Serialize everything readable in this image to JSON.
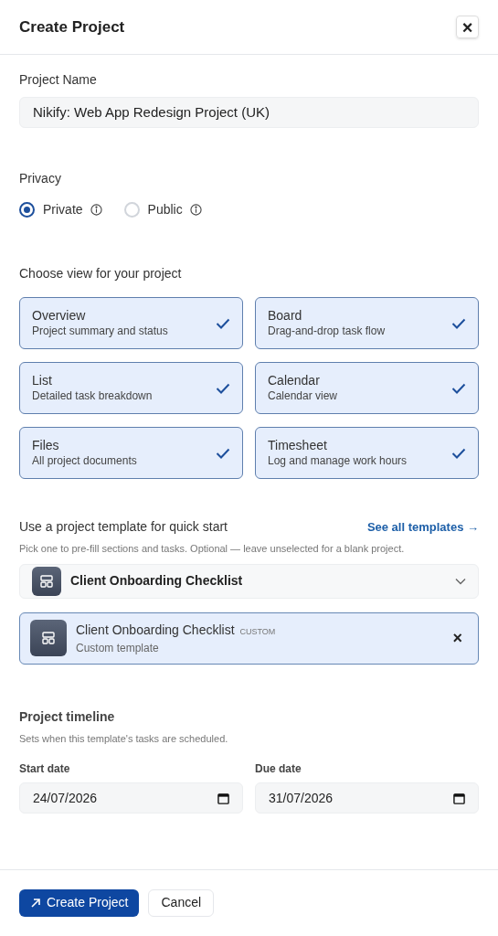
{
  "dialog": {
    "title": "Create Project",
    "close": "×"
  },
  "project_name": {
    "label": "Project Name",
    "value": "Nikify: Web App Redesign Project (UK)"
  },
  "privacy": {
    "label": "Privacy",
    "options": [
      {
        "label": "Private",
        "selected": true
      },
      {
        "label": "Public",
        "selected": false
      }
    ]
  },
  "views": {
    "label": "Choose view for your project",
    "items": [
      {
        "title": "Overview",
        "description": "Project summary and status",
        "selected": true
      },
      {
        "title": "Board",
        "description": "Drag-and-drop task flow",
        "selected": true
      },
      {
        "title": "List",
        "description": "Detailed task breakdown",
        "selected": true
      },
      {
        "title": "Calendar",
        "description": "Calendar view",
        "selected": true
      },
      {
        "title": "Files",
        "description": "All project documents",
        "selected": true
      },
      {
        "title": "Timesheet",
        "description": "Log and manage work hours",
        "selected": true
      }
    ]
  },
  "template": {
    "heading": "Use a project template for quick start",
    "link": "See all templates →",
    "hint": "Pick one to pre-fill sections and tasks. Optional — leave unselected for a blank project.",
    "dropdown": {
      "value": "Client Onboarding Checklist"
    },
    "selected_template": {
      "title": "Client Onboarding Checklist",
      "badge": "CUSTOM",
      "subtitle": "Custom template",
      "remove": "×"
    }
  },
  "timeline": {
    "heading": "Project timeline",
    "hint": "Sets when this template's tasks are scheduled.",
    "fields": [
      {
        "label": "Start date",
        "value": "24/07/2026"
      },
      {
        "label": "Due date",
        "value": "31/07/2026"
      }
    ]
  },
  "footer": {
    "primary": "Create Project",
    "secondary": "Cancel"
  }
}
